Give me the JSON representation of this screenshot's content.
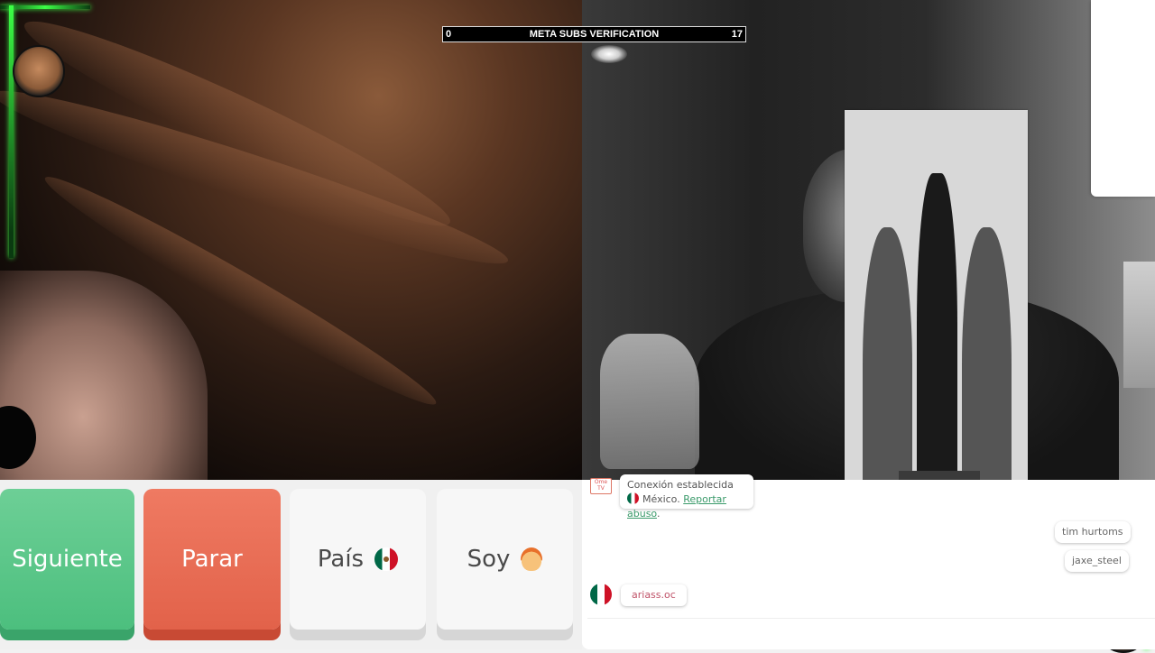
{
  "goal_bar": {
    "left_count": "0",
    "title": "META SUBS VERIFICATION",
    "right_count": "17"
  },
  "controls": {
    "next_label": "Siguiente",
    "stop_label": "Parar",
    "country_label": "País",
    "soy_label": "Soy"
  },
  "chat": {
    "logo_text": "Ome TV",
    "system_message": "Conexión establecida",
    "country_name": "México.",
    "report_link": "Reportar abuso",
    "report_suffix": ".",
    "partner_username": "ariass.oc"
  },
  "viewer_chips": [
    "tim hurtoms",
    "jaxe_steel"
  ],
  "colors": {
    "next": "#4cbf7e",
    "stop": "#e2624a",
    "neon_green": "#3cff46",
    "link": "#3a9a6a"
  },
  "icons": {
    "country_flag": "mexico-flag-icon",
    "soy_emoji": "person-emoji-icon"
  }
}
